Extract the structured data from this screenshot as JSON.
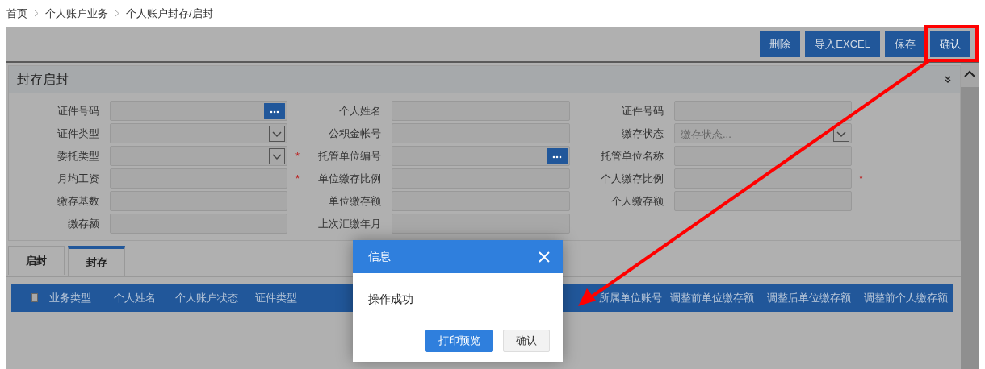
{
  "breadcrumb": [
    "首页",
    "个人账户业务",
    "个人账户封存/启封"
  ],
  "toolbar": {
    "buttons": [
      {
        "label": "删除",
        "highlighted": false
      },
      {
        "label": "导入EXCEL",
        "highlighted": false
      },
      {
        "label": "保存",
        "highlighted": false
      },
      {
        "label": "确认",
        "highlighted": true
      }
    ]
  },
  "panel": {
    "title": "封存启封",
    "rows": [
      [
        {
          "label": "证件号码",
          "kind": "lookup"
        },
        {
          "label": "个人姓名",
          "kind": "text"
        },
        {
          "label": "证件号码",
          "kind": "text"
        }
      ],
      [
        {
          "label": "证件类型",
          "kind": "select"
        },
        {
          "label": "公积金帐号",
          "kind": "text"
        },
        {
          "label": "缴存状态",
          "kind": "select",
          "placeholder": "缴存状态..."
        }
      ],
      [
        {
          "label": "委托类型",
          "kind": "select"
        },
        {
          "label": "托管单位编号",
          "kind": "lookup",
          "required_mark": "*"
        },
        {
          "label": "托管单位名称",
          "kind": "text"
        }
      ],
      [
        {
          "label": "月均工资",
          "kind": "text"
        },
        {
          "label": "单位缴存比例",
          "kind": "text",
          "required_mark": "*"
        },
        {
          "label": "个人缴存比例",
          "kind": "text",
          "required_mark": "*"
        }
      ],
      [
        {
          "label": "缴存基数",
          "kind": "text"
        },
        {
          "label": "单位缴存额",
          "kind": "text"
        },
        {
          "label": "个人缴存额",
          "kind": "text"
        }
      ],
      [
        {
          "label": "缴存额",
          "kind": "text"
        },
        {
          "label": "上次汇缴年月",
          "kind": "text"
        }
      ]
    ]
  },
  "tabs": [
    {
      "label": "启封",
      "selected": false
    },
    {
      "label": "封存",
      "selected": true
    }
  ],
  "table": {
    "select_all_checked": false,
    "columns": [
      "业务类型",
      "个人姓名",
      "个人账户状态",
      "证件类型",
      "所属单位账号",
      "调整前单位缴存额",
      "调整后单位缴存额",
      "调整前个人缴存额"
    ]
  },
  "dialog": {
    "title": "信息",
    "message": "操作成功",
    "buttons": [
      {
        "label": "打印预览",
        "primary": true
      },
      {
        "label": "确认",
        "primary": false
      }
    ]
  }
}
